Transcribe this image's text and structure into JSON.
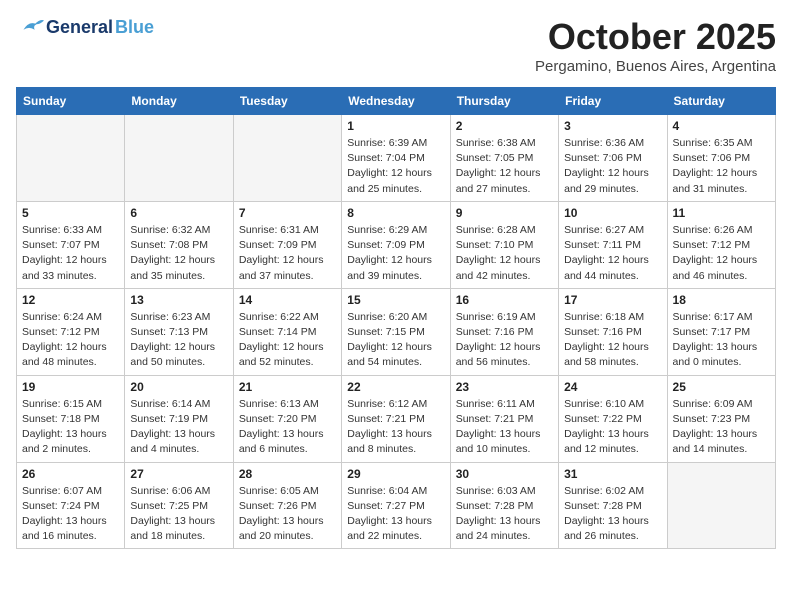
{
  "header": {
    "logo_general": "General",
    "logo_blue": "Blue",
    "month_title": "October 2025",
    "location": "Pergamino, Buenos Aires, Argentina"
  },
  "weekdays": [
    "Sunday",
    "Monday",
    "Tuesday",
    "Wednesday",
    "Thursday",
    "Friday",
    "Saturday"
  ],
  "weeks": [
    [
      {
        "day": "",
        "detail": ""
      },
      {
        "day": "",
        "detail": ""
      },
      {
        "day": "",
        "detail": ""
      },
      {
        "day": "1",
        "detail": "Sunrise: 6:39 AM\nSunset: 7:04 PM\nDaylight: 12 hours\nand 25 minutes."
      },
      {
        "day": "2",
        "detail": "Sunrise: 6:38 AM\nSunset: 7:05 PM\nDaylight: 12 hours\nand 27 minutes."
      },
      {
        "day": "3",
        "detail": "Sunrise: 6:36 AM\nSunset: 7:06 PM\nDaylight: 12 hours\nand 29 minutes."
      },
      {
        "day": "4",
        "detail": "Sunrise: 6:35 AM\nSunset: 7:06 PM\nDaylight: 12 hours\nand 31 minutes."
      }
    ],
    [
      {
        "day": "5",
        "detail": "Sunrise: 6:33 AM\nSunset: 7:07 PM\nDaylight: 12 hours\nand 33 minutes."
      },
      {
        "day": "6",
        "detail": "Sunrise: 6:32 AM\nSunset: 7:08 PM\nDaylight: 12 hours\nand 35 minutes."
      },
      {
        "day": "7",
        "detail": "Sunrise: 6:31 AM\nSunset: 7:09 PM\nDaylight: 12 hours\nand 37 minutes."
      },
      {
        "day": "8",
        "detail": "Sunrise: 6:29 AM\nSunset: 7:09 PM\nDaylight: 12 hours\nand 39 minutes."
      },
      {
        "day": "9",
        "detail": "Sunrise: 6:28 AM\nSunset: 7:10 PM\nDaylight: 12 hours\nand 42 minutes."
      },
      {
        "day": "10",
        "detail": "Sunrise: 6:27 AM\nSunset: 7:11 PM\nDaylight: 12 hours\nand 44 minutes."
      },
      {
        "day": "11",
        "detail": "Sunrise: 6:26 AM\nSunset: 7:12 PM\nDaylight: 12 hours\nand 46 minutes."
      }
    ],
    [
      {
        "day": "12",
        "detail": "Sunrise: 6:24 AM\nSunset: 7:12 PM\nDaylight: 12 hours\nand 48 minutes."
      },
      {
        "day": "13",
        "detail": "Sunrise: 6:23 AM\nSunset: 7:13 PM\nDaylight: 12 hours\nand 50 minutes."
      },
      {
        "day": "14",
        "detail": "Sunrise: 6:22 AM\nSunset: 7:14 PM\nDaylight: 12 hours\nand 52 minutes."
      },
      {
        "day": "15",
        "detail": "Sunrise: 6:20 AM\nSunset: 7:15 PM\nDaylight: 12 hours\nand 54 minutes."
      },
      {
        "day": "16",
        "detail": "Sunrise: 6:19 AM\nSunset: 7:16 PM\nDaylight: 12 hours\nand 56 minutes."
      },
      {
        "day": "17",
        "detail": "Sunrise: 6:18 AM\nSunset: 7:16 PM\nDaylight: 12 hours\nand 58 minutes."
      },
      {
        "day": "18",
        "detail": "Sunrise: 6:17 AM\nSunset: 7:17 PM\nDaylight: 13 hours\nand 0 minutes."
      }
    ],
    [
      {
        "day": "19",
        "detail": "Sunrise: 6:15 AM\nSunset: 7:18 PM\nDaylight: 13 hours\nand 2 minutes."
      },
      {
        "day": "20",
        "detail": "Sunrise: 6:14 AM\nSunset: 7:19 PM\nDaylight: 13 hours\nand 4 minutes."
      },
      {
        "day": "21",
        "detail": "Sunrise: 6:13 AM\nSunset: 7:20 PM\nDaylight: 13 hours\nand 6 minutes."
      },
      {
        "day": "22",
        "detail": "Sunrise: 6:12 AM\nSunset: 7:21 PM\nDaylight: 13 hours\nand 8 minutes."
      },
      {
        "day": "23",
        "detail": "Sunrise: 6:11 AM\nSunset: 7:21 PM\nDaylight: 13 hours\nand 10 minutes."
      },
      {
        "day": "24",
        "detail": "Sunrise: 6:10 AM\nSunset: 7:22 PM\nDaylight: 13 hours\nand 12 minutes."
      },
      {
        "day": "25",
        "detail": "Sunrise: 6:09 AM\nSunset: 7:23 PM\nDaylight: 13 hours\nand 14 minutes."
      }
    ],
    [
      {
        "day": "26",
        "detail": "Sunrise: 6:07 AM\nSunset: 7:24 PM\nDaylight: 13 hours\nand 16 minutes."
      },
      {
        "day": "27",
        "detail": "Sunrise: 6:06 AM\nSunset: 7:25 PM\nDaylight: 13 hours\nand 18 minutes."
      },
      {
        "day": "28",
        "detail": "Sunrise: 6:05 AM\nSunset: 7:26 PM\nDaylight: 13 hours\nand 20 minutes."
      },
      {
        "day": "29",
        "detail": "Sunrise: 6:04 AM\nSunset: 7:27 PM\nDaylight: 13 hours\nand 22 minutes."
      },
      {
        "day": "30",
        "detail": "Sunrise: 6:03 AM\nSunset: 7:28 PM\nDaylight: 13 hours\nand 24 minutes."
      },
      {
        "day": "31",
        "detail": "Sunrise: 6:02 AM\nSunset: 7:28 PM\nDaylight: 13 hours\nand 26 minutes."
      },
      {
        "day": "",
        "detail": ""
      }
    ]
  ]
}
